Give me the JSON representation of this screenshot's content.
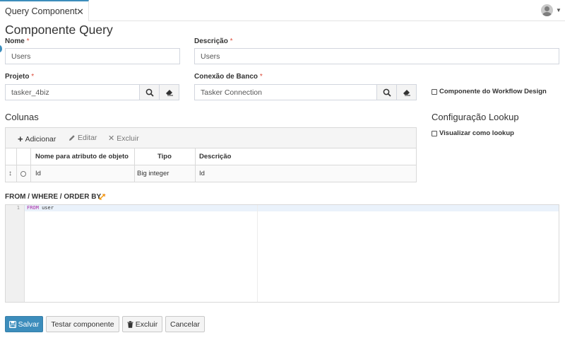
{
  "tabs": [
    {
      "label": "Query Component",
      "close": "✕"
    }
  ],
  "page": {
    "title": "Componente Query"
  },
  "form": {
    "nome": {
      "label": "Nome",
      "required": "*",
      "value": "Users"
    },
    "descricao": {
      "label": "Descrição",
      "required": "*",
      "value": "Users"
    },
    "projeto": {
      "label": "Projeto",
      "required": "*",
      "value": "tasker_4biz"
    },
    "conexao": {
      "label": "Conexão de Banco",
      "required": "*",
      "value": "Tasker Connection"
    },
    "workflow_checkbox": {
      "label": "Componente do Workflow Design",
      "checked": false
    }
  },
  "colunas": {
    "title": "Colunas",
    "toolbar": {
      "add": "Adicionar",
      "edit": "Editar",
      "delete": "Excluir"
    },
    "headers": [
      "Nome para atributo de objeto",
      "Tipo",
      "Descrição"
    ],
    "rows": [
      {
        "nome": "Id",
        "tipo": "Big integer",
        "descricao": "Id"
      }
    ]
  },
  "lookup": {
    "title": "Configuração Lookup",
    "checkbox": {
      "label": "Visualizar como lookup",
      "checked": false
    }
  },
  "sql": {
    "label": "FROM / WHERE / ORDER BY",
    "required": "*",
    "lines": [
      {
        "number": "1",
        "keyword": "FROM",
        "rest": " user"
      }
    ]
  },
  "buttons": {
    "save": "Salvar",
    "test": "Testar componente",
    "delete": "Excluir",
    "cancel": "Cancelar"
  },
  "colors": {
    "primary": "#3c8dbc",
    "required": "#dd4b39",
    "keyword": "#a626a4",
    "expand_icon": "#f39c12"
  }
}
